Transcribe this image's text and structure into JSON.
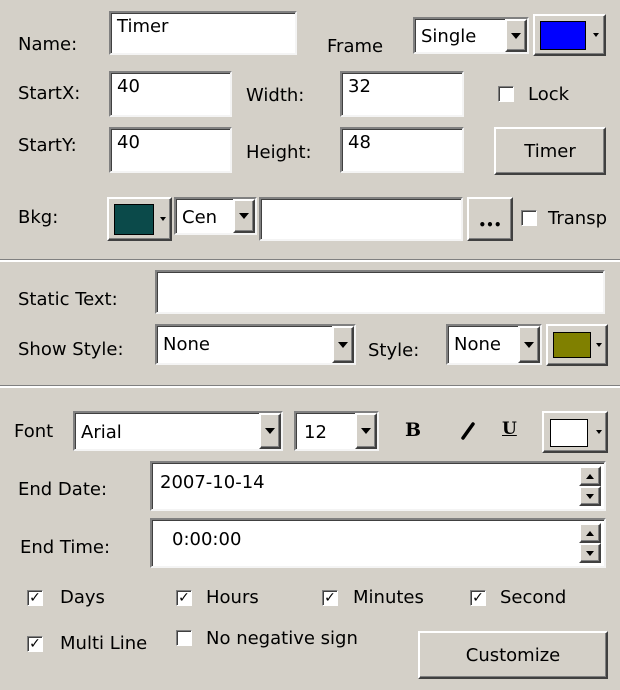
{
  "general": {
    "name_label": "Name:",
    "name_value": "Timer",
    "frame_label": "Frame",
    "frame_value": "Single",
    "frame_color": "#0000ff",
    "startx_label": "StartX:",
    "startx_value": "40",
    "width_label": "Width:",
    "width_value": "32",
    "lock_label": "Lock",
    "lock_checked": false,
    "starty_label": "StartY:",
    "starty_value": "40",
    "height_label": "Height:",
    "height_value": "48",
    "timer_button_label": "Timer",
    "bkg_label": "Bkg:",
    "bkg_color": "#0b4a4a",
    "bkg_align_value": "Cen",
    "bkg_image_value": "",
    "browse_label": "•••",
    "transparent_label": "Transp",
    "transparent_checked": false
  },
  "static": {
    "static_text_label": "Static Text:",
    "static_text_value": "",
    "show_style_label": "Show Style:",
    "show_style_value": "None",
    "style_label": "Style:",
    "style_value": "None",
    "style_color": "#808000"
  },
  "timer": {
    "font_label": "Font",
    "font_value": "Arial",
    "size_value": "12",
    "bold_label": "B",
    "italic_label": "I",
    "underline_label": "U",
    "font_color": "#ffffff",
    "end_date_label": "End Date:",
    "end_date_value": "2007-10-14",
    "end_time_label": "End Time:",
    "end_time_value": "0:00:00",
    "days_label": "Days",
    "hours_label": "Hours",
    "minutes_label": "Minutes",
    "second_label": "Second",
    "multi_line_label": "Multi Line",
    "no_negative_label": "No negative sign",
    "customize_label": "Customize",
    "check_mark": "✓"
  }
}
